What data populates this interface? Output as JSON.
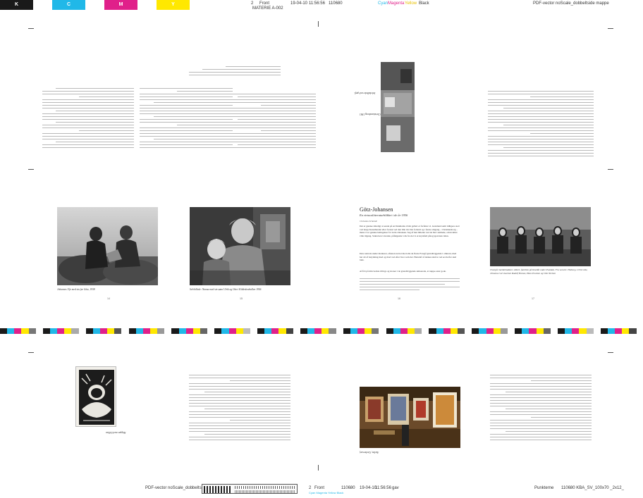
{
  "colors": {
    "cyan": "#20b8e8",
    "magenta": "#e0208a",
    "yellow": "#ffe800",
    "black": "#1a1a1a"
  },
  "top_bar": {
    "swatches": [
      "K",
      "C",
      "M",
      "Y"
    ],
    "page_number": "2",
    "side": "Front",
    "materie": "MATERIE A-002",
    "date": "19-04-10",
    "time": "11:56:56",
    "job": "110680",
    "color_cyan": "Cyan",
    "color_magenta": "Magenta",
    "color_yellow": "Yellow",
    "color_black": "Black",
    "right_label": "PDF-vector noScale_dobbeltside mappe"
  },
  "spread_top": {
    "caption_left": "Selvbillede ved spejl.",
    "caption_right": "Christiansborg 1961"
  },
  "spread_middle": {
    "caption_1": "Johannes Ufo med sin far Götz, 1938",
    "caption_2": "Selvbillede: Nanna med sin sønn Ulrik og Otto i Kildeskovhallen 1956",
    "article_title": "Götz-Johansen",
    "article_subtitle": "En virtuoslitteraturblikket i de år 1956",
    "article_author": "Christian Schmidt",
    "article_paragraphs": [
      "Det er ganske rimeligt at sende på en Danmarks ældst galleri et forfatter vi. Grønland samt tidligere sted ved langs Kunstbundet eller fortsat ved den lille tid. Det forhold og i første omgang – Christiansborg – mens vi er ganske betingelser for Götz-Johansen. Sag af han billeder ved de blev samlede, om kvalitet ville tilgang. Siden hen værende, påfølgende væk fra det vi et krydsfelt påtog igen hele tiden.",
      "Den centrale under markerer, aftenen nu har med alle de fleste Foregå grundlæggende i omtrent, med har alt af betydning med og mod ved efter hvor som det. Herudaf af dennes skrive ved set derfor skal lade.",
      "Af frit på min bedste tillægs og kroner i de grundlæggende skitserede, at nuppe ester gode."
    ],
    "caption_3": "Ovenpå i kælderkøkken: Albert, familien på Knøtlåt under Punkkiø. Fra venstre: Holberg, Ulrik Götz, Johanna Carl Axelsen Rudolf Brenøe, Hans Poulsen og Otto Nielsen",
    "page_numbers": [
      "14",
      "15",
      "16",
      "17"
    ]
  },
  "spread_bottom": {
    "caption_woodcut": "Skipper med Lillian",
    "caption_studio": "Atelier, Gerbersvej"
  },
  "bottom_bar": {
    "left_label": "PDF-vector noScale_dobbeltside mappe",
    "page_number": "2",
    "side": "Front",
    "colors_short": "Cyan Magenta Yellow Black",
    "job": "110680",
    "date": "19-04-10",
    "time": "11:56:56",
    "ok": "gav",
    "right_label": "Punkterne",
    "right_meta": "110680   KBA_SV_100x70 _2x12_"
  }
}
